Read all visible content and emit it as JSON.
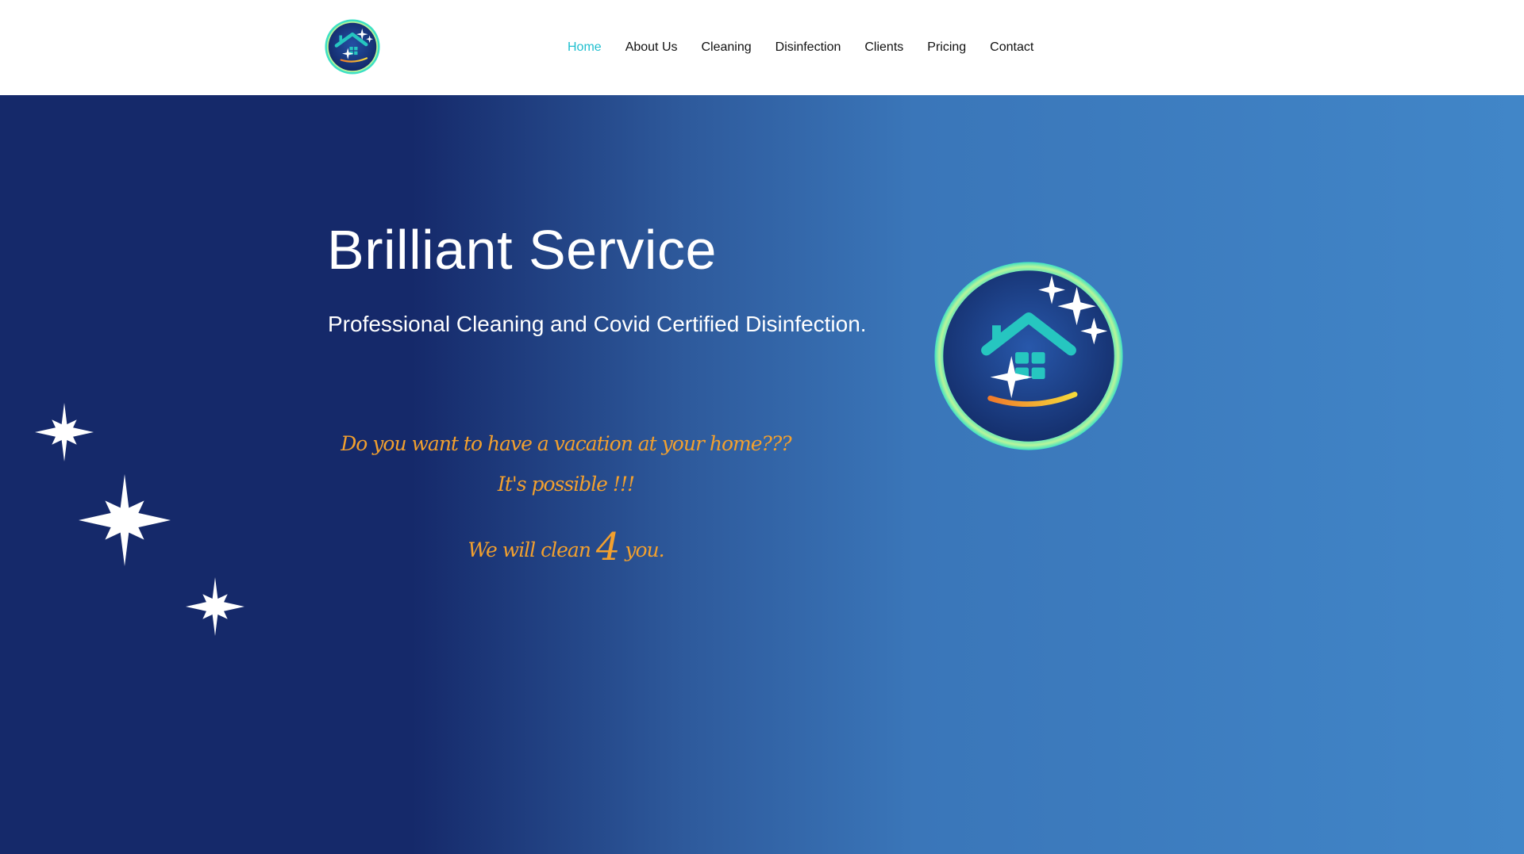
{
  "nav": {
    "items": [
      {
        "label": "Home",
        "active": true
      },
      {
        "label": "About Us",
        "active": false
      },
      {
        "label": "Cleaning",
        "active": false
      },
      {
        "label": "Disinfection",
        "active": false
      },
      {
        "label": "Clients",
        "active": false
      },
      {
        "label": "Pricing",
        "active": false
      },
      {
        "label": "Contact",
        "active": false
      }
    ]
  },
  "hero": {
    "title": "Brilliant Service",
    "subtitle": "Professional Cleaning and Covid Certified Disinfection.",
    "tagline_1": "Do you want to have a vacation at your home???",
    "tagline_2": "It's possible !!!",
    "tagline_3_before": "We will clean ",
    "tagline_3_number": "4",
    "tagline_3_after": " you."
  },
  "icons": {
    "header_logo": "house-sparkle-logo-icon",
    "hero_logo": "house-sparkle-logo-icon",
    "sparkles": "sparkle-star-icon"
  },
  "colors": {
    "accent": "#1fbfcf",
    "tagline": "#f2a02e",
    "hero_dark": "#15296a",
    "hero_light": "#4186c8",
    "logo_ring_outer": "#3de0c4",
    "logo_ring_inner": "#b8f59a",
    "logo_bg": "#1c3a86"
  }
}
